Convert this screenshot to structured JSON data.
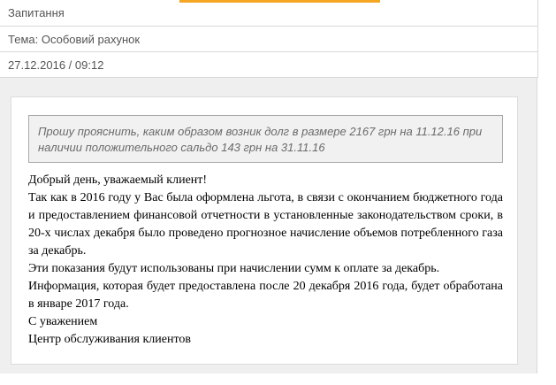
{
  "header": {
    "title": "Запитання",
    "topic": "Тема: Особовий рахунок",
    "datetime": "27.12.2016 / 09:12"
  },
  "question": {
    "text": "Прошу прояснить, каким образом возник долг в размере 2167 грн на 11.12.16 при наличии положительного сальдо 143 грн на 31.11.16"
  },
  "answer": {
    "greeting": "Добрый день, уважаемый клиент!",
    "paragraph1": "Так как в 2016 году у Вас была оформлена льгота, в связи с окончанием бюджетного года и предоставлением финансовой отчетности в установленные законодательством сроки, в 20-х числах декабря было проведено прогнозное начисление объемов потребленного газа за декабрь.",
    "paragraph2": "Эти показания будут использованы при начислении сумм к оплате за декабрь.",
    "paragraph3": "Информация, которая будет предоставлена после 20 декабря 2016 года, будет обработана в январе 2017 года.",
    "closing": "С уважением",
    "signature": "Центр обслуживания клиентов"
  },
  "colors": {
    "accent": "#f5a623",
    "panel_bg": "#efefef",
    "question_bg": "#f1f1f1",
    "border": "#d9d9d9"
  }
}
